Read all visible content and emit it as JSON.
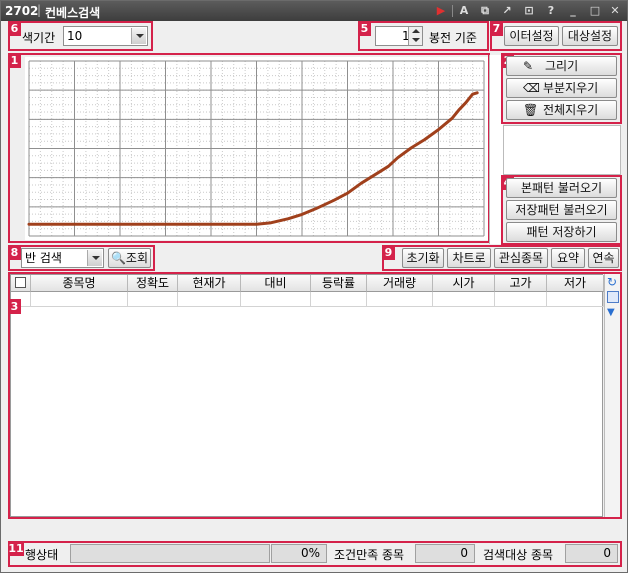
{
  "window": {
    "screen_id": "2702",
    "title": "컨베스검색",
    "title_buttons": [
      "play-icon",
      "font-icon",
      "link-icon",
      "pin-icon",
      "copy-icon",
      "help-icon",
      "minimize-icon",
      "maximize-icon",
      "close-icon"
    ],
    "title_glyphs": {
      "play": "▶",
      "font": "A",
      "link": "⧉",
      "pin": "↗",
      "copy": "⊡",
      "help": "?",
      "minimize": "_",
      "maximize": "□",
      "close": "✕"
    }
  },
  "badges": {
    "chart": "1",
    "draw_tools": "2",
    "results": "3",
    "patterns": "4",
    "candle_basis": "5",
    "period": "6",
    "settings": "7",
    "search_mode": "8",
    "actions": "9",
    "status": "11"
  },
  "top_bar": {
    "period_label": "색기간",
    "period_value": "10",
    "candle_value": "1",
    "candle_label": "봉전 기준",
    "data_settings": "이터설정",
    "target_settings": "대상설정"
  },
  "draw_tools": {
    "draw": "그리기",
    "partial_erase": "부분지우기",
    "erase_all": "전체지우기"
  },
  "patterns": {
    "load_basic": "본패턴 불러오기",
    "load_saved": "저장패턴 불러오기",
    "save_pattern": "패턴 저장하기"
  },
  "search_bar": {
    "mode_value": "반 검색",
    "query_button": "조회",
    "reset": "초기화",
    "to_chart": "차트로",
    "watchlist": "관심종목",
    "summary": "요약",
    "continuous": "연속"
  },
  "table": {
    "columns": [
      "종목명",
      "정확도",
      "현재가",
      "대비",
      "등락률",
      "거래량",
      "시가",
      "고가",
      "저가"
    ],
    "rows": []
  },
  "status_bar": {
    "progress_label": "행상태",
    "progress_fraction": 0.0,
    "progress_text": "0%",
    "matched_label": "조건만족 종목",
    "matched_count": "0",
    "target_label": "검색대상 종목",
    "target_count": "0"
  },
  "colors": {
    "accent": "#d4224a",
    "curve": "#a0401c",
    "titlebar": "#3d3d3d"
  },
  "chart_data": {
    "type": "line",
    "grid": true,
    "columns": 10,
    "rows": 6,
    "drawn_pattern": [
      [
        0.0,
        0.0
      ],
      [
        0.5,
        0.0
      ],
      [
        1.0,
        0.0
      ],
      [
        1.5,
        0.0
      ],
      [
        2.0,
        0.0
      ],
      [
        2.5,
        0.0
      ],
      [
        3.0,
        0.0
      ],
      [
        3.5,
        0.0
      ],
      [
        4.0,
        0.0
      ],
      [
        4.5,
        0.0
      ],
      [
        5.0,
        0.0
      ],
      [
        5.3,
        0.05
      ],
      [
        5.7,
        0.2
      ],
      [
        6.0,
        0.35
      ],
      [
        6.3,
        0.55
      ],
      [
        6.7,
        0.85
      ],
      [
        7.0,
        1.1
      ],
      [
        7.3,
        1.45
      ],
      [
        7.6,
        1.75
      ],
      [
        7.9,
        2.05
      ],
      [
        8.1,
        2.35
      ],
      [
        8.4,
        2.7
      ],
      [
        8.7,
        3.0
      ],
      [
        9.0,
        3.35
      ],
      [
        9.3,
        3.75
      ],
      [
        9.45,
        4.05
      ],
      [
        9.6,
        4.3
      ],
      [
        9.75,
        4.6
      ],
      [
        9.85,
        4.65
      ]
    ]
  }
}
